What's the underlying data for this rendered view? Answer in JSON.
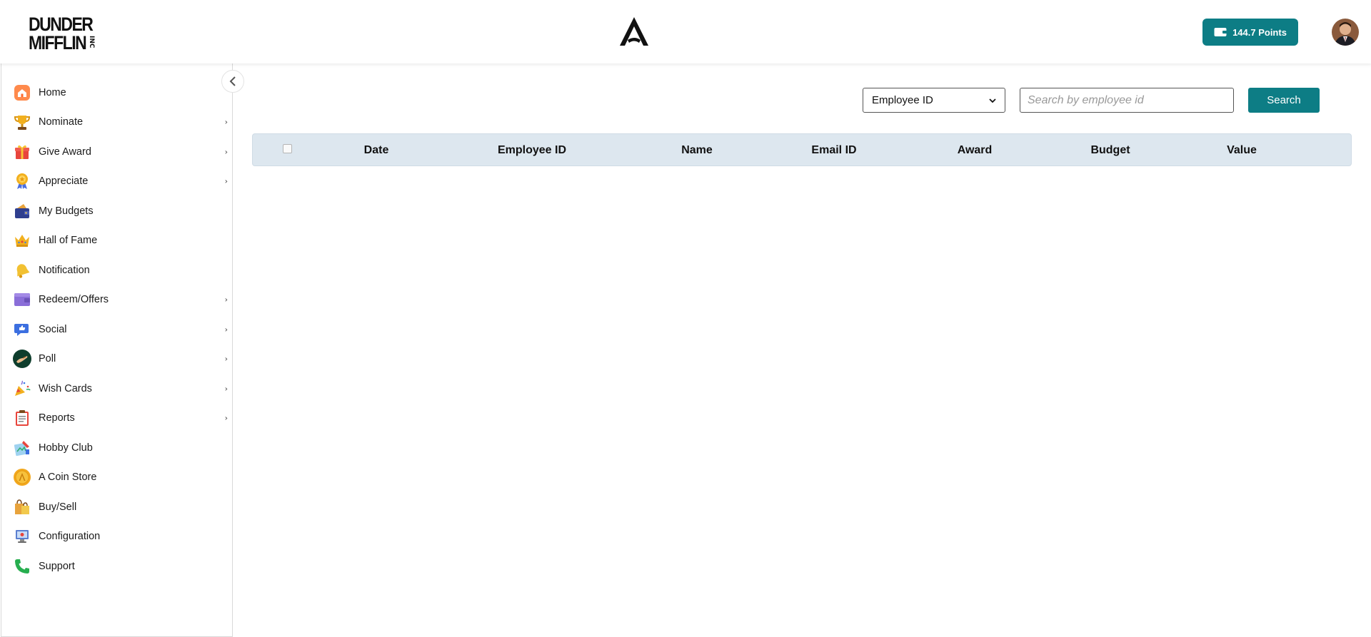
{
  "header": {
    "logo_line1": "DUNDER",
    "logo_line2": "MIFFLIN",
    "logo_suffix": "INC",
    "points_label": "144.7  Points",
    "accent_color": "#0d7d85"
  },
  "sidebar": {
    "items": [
      {
        "label": "Home",
        "icon": "home-icon",
        "has_submenu": false
      },
      {
        "label": "Nominate",
        "icon": "trophy-icon",
        "has_submenu": true
      },
      {
        "label": "Give Award",
        "icon": "gift-icon",
        "has_submenu": true
      },
      {
        "label": "Appreciate",
        "icon": "medal-icon",
        "has_submenu": true
      },
      {
        "label": "My Budgets",
        "icon": "wallet-icon",
        "has_submenu": false
      },
      {
        "label": "Hall of Fame",
        "icon": "crown-icon",
        "has_submenu": false
      },
      {
        "label": "Notification",
        "icon": "bell-icon",
        "has_submenu": false
      },
      {
        "label": "Redeem/Offers",
        "icon": "redeem-wallet-icon",
        "has_submenu": true
      },
      {
        "label": "Social",
        "icon": "social-chat-icon",
        "has_submenu": true
      },
      {
        "label": "Poll",
        "icon": "poll-icon",
        "has_submenu": true
      },
      {
        "label": "Wish Cards",
        "icon": "party-popper-icon",
        "has_submenu": true
      },
      {
        "label": "Reports",
        "icon": "clipboard-icon",
        "has_submenu": true
      },
      {
        "label": "Hobby Club",
        "icon": "palette-icon",
        "has_submenu": false
      },
      {
        "label": "A Coin Store",
        "icon": "coin-icon",
        "has_submenu": false
      },
      {
        "label": "Buy/Sell",
        "icon": "shopping-bags-icon",
        "has_submenu": false
      },
      {
        "label": "Configuration",
        "icon": "computer-config-icon",
        "has_submenu": false
      },
      {
        "label": "Support",
        "icon": "phone-icon",
        "has_submenu": false
      }
    ]
  },
  "search": {
    "filter_selected": "Employee ID",
    "placeholder": "Search by employee id",
    "button_label": "Search"
  },
  "table": {
    "columns": [
      "Date",
      "Employee ID",
      "Name",
      "Email ID",
      "Award",
      "Budget",
      "Value"
    ],
    "rows": []
  }
}
